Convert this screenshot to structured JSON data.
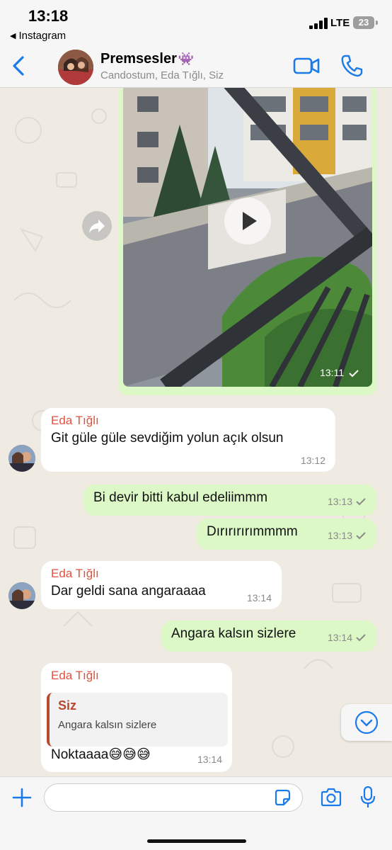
{
  "status_bar": {
    "time": "13:18",
    "back_app": "Instagram",
    "network": "LTE",
    "battery": "23"
  },
  "header": {
    "title": "Premsesler",
    "title_emoji": "👾",
    "subtitle": "Candostum, Eda Tığlı, Siz"
  },
  "video_message": {
    "time": "13:11"
  },
  "messages": [
    {
      "sender": "Eda Tığlı",
      "text": "Git güle güle sevdiğim yolun açık olsun",
      "time": "13:12"
    },
    {
      "text": "Bi devir bitti kabul edeliimmm",
      "time": "13:13"
    },
    {
      "text": "Dırırırırımmmm",
      "time": "13:13"
    },
    {
      "sender": "Eda Tığlı",
      "text": "Dar geldi sana angaraaaa",
      "time": "13:14"
    },
    {
      "text": "Angara kalsın sizlere",
      "time": "13:14"
    },
    {
      "sender": "Eda Tığlı",
      "quote_name": "Siz",
      "quote_text": "Angara kalsın sizlere",
      "text": "Noktaaaa😅😅😅",
      "time": "13:14"
    }
  ],
  "input": {
    "placeholder": ""
  },
  "colors": {
    "accent": "#1a7ae8",
    "outgoing_bubble": "#dcf8c6",
    "incoming_bubble": "#ffffff",
    "sender_name": "#e0533f",
    "quote_bar": "#b54a2e",
    "chat_background": "#efeae2"
  },
  "icons": [
    "back-arrow-icon",
    "video-call-icon",
    "phone-icon",
    "forward-icon",
    "play-icon",
    "check-icon",
    "chevron-down-icon",
    "plus-icon",
    "sticker-icon",
    "camera-icon",
    "microphone-icon"
  ]
}
